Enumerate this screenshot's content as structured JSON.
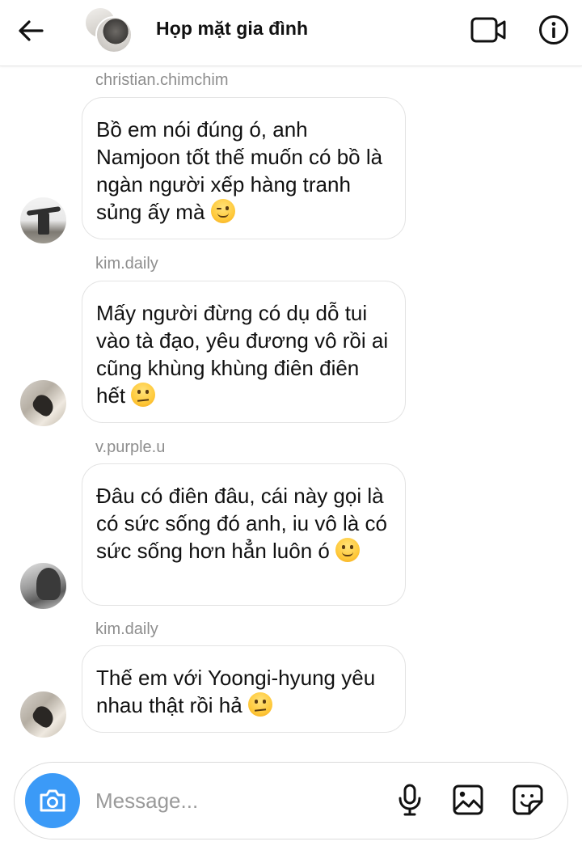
{
  "header": {
    "title": "Họp mặt gia đình",
    "back_icon": "arrow-left-icon",
    "video_icon": "video-camera-icon",
    "info_icon": "info-icon"
  },
  "messages": [
    {
      "sender": "christian.chimchim",
      "text": "Bồ em nói đúng ó, anh Namjoon tốt thế muốn có bồ là ngàn người xếp hàng tranh sủng ấy mà",
      "emoji": "winking-face-icon"
    },
    {
      "sender": "kim.daily",
      "text": "Mấy người đừng có dụ dỗ tui vào tà đạo, yêu đương vô rồi ai cũng khùng khùng điên điên hết",
      "emoji": "unamused-face-icon"
    },
    {
      "sender": "v.purple.u",
      "text": "Đâu có điên đâu, cái này gọi là có sức sống đó anh, iu vô là có sức sống hơn hẳn luôn ó",
      "emoji": "smiling-face-icon"
    },
    {
      "sender": "kim.daily",
      "text": "Thế em với Yoongi-hyung yêu nhau thật rồi hả",
      "emoji": "unamused-face-icon"
    }
  ],
  "composer": {
    "placeholder": "Message...",
    "value": "",
    "camera_icon": "camera-icon",
    "mic_icon": "microphone-icon",
    "gallery_icon": "gallery-icon",
    "sticker_icon": "sticker-icon",
    "accent_color": "#3b9af7"
  }
}
